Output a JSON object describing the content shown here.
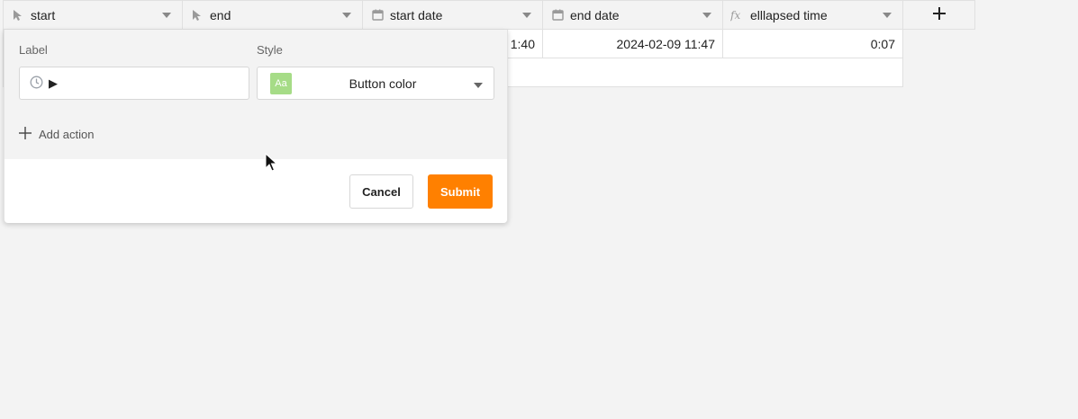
{
  "columns": [
    {
      "title": "start",
      "icon": "button-pointer-icon"
    },
    {
      "title": "end",
      "icon": "button-pointer-icon"
    },
    {
      "title": "start date",
      "icon": "calendar-icon"
    },
    {
      "title": "end date",
      "icon": "calendar-icon"
    },
    {
      "title": "elllapsed time",
      "icon": "formula-icon"
    }
  ],
  "rows": [
    {
      "cells": [
        "",
        "",
        "1:40",
        "2024-02-09 11:47",
        "0:07"
      ]
    }
  ],
  "popup": {
    "label_heading": "Label",
    "style_heading": "Style",
    "label_icon": "clock-icon",
    "label_value": "▶",
    "swatch_text": "Aa",
    "style_value": "Button color",
    "add_action": "Add action",
    "cancel": "Cancel",
    "submit": "Submit"
  },
  "colors": {
    "submit": "#ff8000",
    "swatch": "#a6dc87"
  }
}
